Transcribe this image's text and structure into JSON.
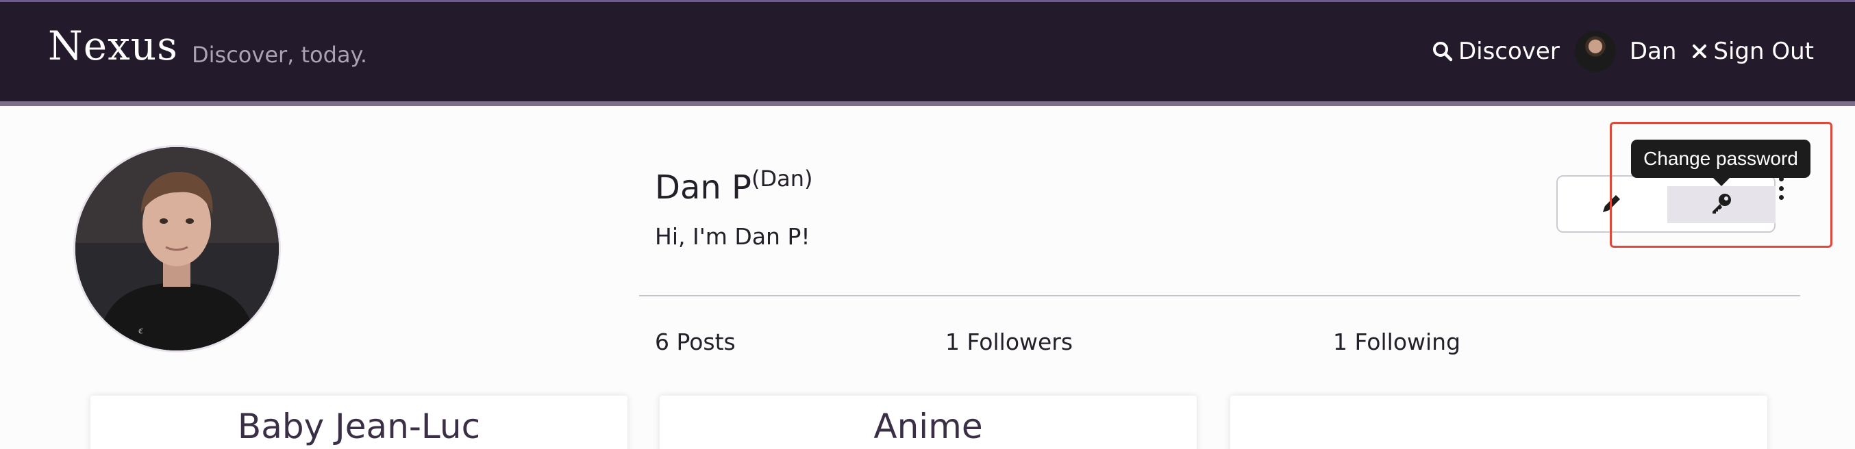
{
  "navbar": {
    "brand": "Nexus",
    "tagline": "Discover, today.",
    "discover_label": "Discover",
    "user_label": "Dan",
    "signout_label": "Sign Out",
    "icons": {
      "discover": "search-icon",
      "signout": "close-icon"
    }
  },
  "profile": {
    "name": "Dan P",
    "username": "(Dan)",
    "bio": "Hi, I'm Dan P!",
    "actions": {
      "edit_icon": "pencil-icon",
      "password_icon": "key-icon",
      "more_icon": "kebab-menu-icon",
      "tooltip": "Change password"
    },
    "stats": {
      "posts": "6 Posts",
      "followers": "1 Followers",
      "following": "1 Following"
    }
  },
  "cards": [
    {
      "title": "Baby Jean-Luc"
    },
    {
      "title": "Anime"
    },
    {
      "title": ""
    }
  ],
  "colors": {
    "navbar_bg": "#231a2b",
    "navbar_border": "#7d6f8a",
    "highlight": "#e0483a",
    "tooltip_bg": "#1c1c1c"
  }
}
